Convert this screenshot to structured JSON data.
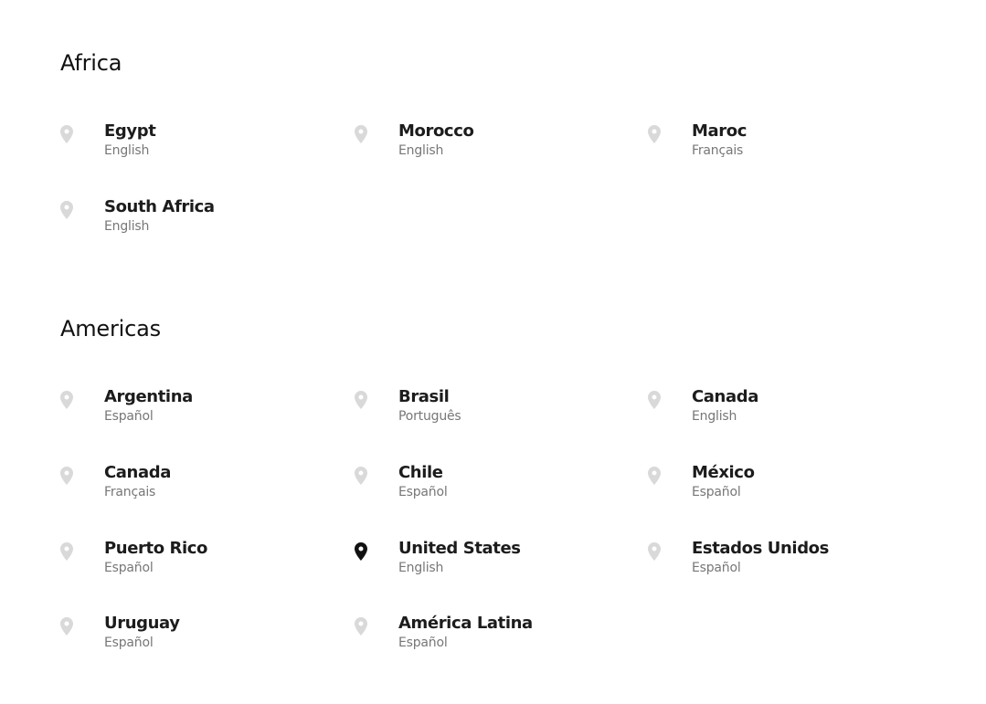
{
  "regions": [
    {
      "title": "Africa",
      "items": [
        {
          "country": "Egypt",
          "language": "English",
          "selected": false
        },
        {
          "country": "Morocco",
          "language": "English",
          "selected": false
        },
        {
          "country": "Maroc",
          "language": "Français",
          "selected": false
        },
        {
          "country": "South Africa",
          "language": "English",
          "selected": false
        }
      ]
    },
    {
      "title": "Americas",
      "items": [
        {
          "country": "Argentina",
          "language": "Español",
          "selected": false
        },
        {
          "country": "Brasil",
          "language": "Português",
          "selected": false
        },
        {
          "country": "Canada",
          "language": "English",
          "selected": false
        },
        {
          "country": "Canada",
          "language": "Français",
          "selected": false
        },
        {
          "country": "Chile",
          "language": "Español",
          "selected": false
        },
        {
          "country": "México",
          "language": "Español",
          "selected": false
        },
        {
          "country": "Puerto Rico",
          "language": "Español",
          "selected": false
        },
        {
          "country": "United States",
          "language": "English",
          "selected": true
        },
        {
          "country": "Estados Unidos",
          "language": "Español",
          "selected": false
        },
        {
          "country": "Uruguay",
          "language": "Español",
          "selected": false
        },
        {
          "country": "América Latina",
          "language": "Español",
          "selected": false
        }
      ]
    }
  ],
  "icons": {
    "pin": "map-pin-icon",
    "pin_color_inactive": "#d9d9d9",
    "pin_color_selected": "#111111"
  }
}
